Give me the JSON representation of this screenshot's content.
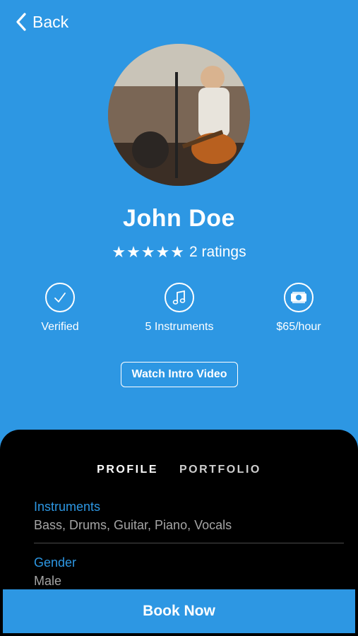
{
  "nav": {
    "back_label": "Back"
  },
  "profile": {
    "name": "John Doe",
    "stars": "★★★★★",
    "rating_count": 5,
    "ratings_text": "2 ratings"
  },
  "features": [
    {
      "label": "Verified",
      "icon": "check-icon"
    },
    {
      "label": "5 Instruments",
      "icon": "music-note-icon"
    },
    {
      "label": "$65/hour",
      "icon": "money-icon"
    }
  ],
  "video_button_label": "Watch Intro Video",
  "tabs": [
    {
      "label": "PROFILE",
      "active": true
    },
    {
      "label": "PORTFOLIO",
      "active": false
    }
  ],
  "fields": [
    {
      "label": "Instruments",
      "value": "Bass, Drums, Guitar, Piano, Vocals"
    },
    {
      "label": "Gender",
      "value": "Male"
    }
  ],
  "book_button_label": "Book Now",
  "colors": {
    "accent": "#2d97e3",
    "panel": "#000000",
    "value_text": "#a5a5a5",
    "text": "#ffffff"
  }
}
